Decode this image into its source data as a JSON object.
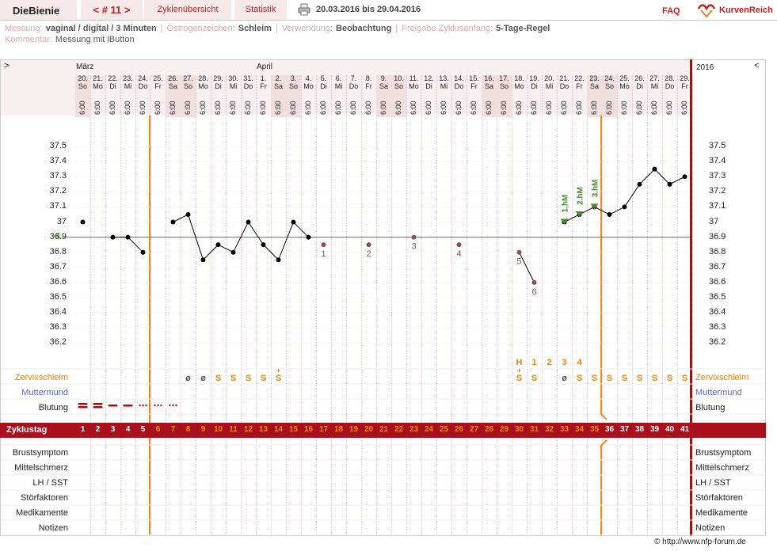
{
  "app": {
    "brand": "DieBienie",
    "cycle": "< # 11 >",
    "tab_overview": "Zyklenübersicht",
    "tab_stats": "Statistik",
    "date_range": "20.03.2016 bis 29.04.2016",
    "faq": "FAQ",
    "kr_logo": "KurvenReich"
  },
  "info": {
    "messung_lbl": "Messung:",
    "messung_val": "vaginal / digital / 3 Minuten",
    "oestro_lbl": "Östrogenzeichen:",
    "oestro_val": "Schleim",
    "verw_lbl": "Verwendung:",
    "verw_val": "Beobachtung",
    "freigabe_lbl": "Freigabe Zyklusanfang:",
    "freigabe_val": "5-Tage-Regel",
    "komm_lbl": "Kommentar:",
    "komm_val": "Messung mit iButton"
  },
  "chart": {
    "nav_left": ">",
    "nav_right": "<",
    "month1": "März",
    "month2": "April",
    "year": "2016",
    "hl_label": "HL",
    "yticks": [
      "37.5",
      "37.4",
      "37.3",
      "37.2",
      "37.1",
      "37",
      "36.9",
      "36.8",
      "36.7",
      "36.6",
      "36.5",
      "36.4",
      "36.3",
      "36.2"
    ],
    "days": [
      {
        "d": "20.",
        "w": "So",
        "we": true
      },
      {
        "d": "21.",
        "w": "Mo"
      },
      {
        "d": "22.",
        "w": "Di"
      },
      {
        "d": "23.",
        "w": "Mi"
      },
      {
        "d": "24.",
        "w": "Do"
      },
      {
        "d": "25.",
        "w": "Fr"
      },
      {
        "d": "26.",
        "w": "Sa",
        "we": true
      },
      {
        "d": "27.",
        "w": "So",
        "we": true
      },
      {
        "d": "28.",
        "w": "Mo"
      },
      {
        "d": "29.",
        "w": "Di"
      },
      {
        "d": "30.",
        "w": "Mi"
      },
      {
        "d": "31.",
        "w": "Do"
      },
      {
        "d": "1.",
        "w": "Fr"
      },
      {
        "d": "2.",
        "w": "Sa",
        "we": true
      },
      {
        "d": "3.",
        "w": "So",
        "we": true
      },
      {
        "d": "4.",
        "w": "Mo"
      },
      {
        "d": "5.",
        "w": "Di"
      },
      {
        "d": "6.",
        "w": "Mi"
      },
      {
        "d": "7.",
        "w": "Do"
      },
      {
        "d": "8.",
        "w": "Fr"
      },
      {
        "d": "9.",
        "w": "Sa",
        "we": true
      },
      {
        "d": "10.",
        "w": "So",
        "we": true
      },
      {
        "d": "11.",
        "w": "Mo"
      },
      {
        "d": "12.",
        "w": "Di"
      },
      {
        "d": "13.",
        "w": "Mi"
      },
      {
        "d": "14.",
        "w": "Do"
      },
      {
        "d": "15.",
        "w": "Fr"
      },
      {
        "d": "16.",
        "w": "Sa",
        "we": true
      },
      {
        "d": "17.",
        "w": "So",
        "we": true
      },
      {
        "d": "18.",
        "w": "Mo"
      },
      {
        "d": "19.",
        "w": "Di"
      },
      {
        "d": "20.",
        "w": "Mi"
      },
      {
        "d": "21.",
        "w": "Do"
      },
      {
        "d": "22.",
        "w": "Fr"
      },
      {
        "d": "23.",
        "w": "Sa",
        "we": true
      },
      {
        "d": "24.",
        "w": "So",
        "we": true
      },
      {
        "d": "25.",
        "w": "Mo"
      },
      {
        "d": "26.",
        "w": "Di"
      },
      {
        "d": "27.",
        "w": "Mi"
      },
      {
        "d": "28.",
        "w": "Do"
      },
      {
        "d": "29.",
        "w": "Fr"
      }
    ],
    "time": "6:00",
    "temps": [
      37.0,
      null,
      36.9,
      36.9,
      36.8,
      null,
      37.0,
      37.05,
      36.75,
      36.85,
      36.8,
      37.0,
      36.85,
      36.75,
      37.0,
      36.9,
      36.85,
      null,
      null,
      36.85,
      null,
      null,
      36.9,
      null,
      null,
      36.85,
      null,
      null,
      null,
      36.8,
      36.6,
      null,
      37.0,
      37.05,
      37.1,
      37.05,
      37.1,
      37.25,
      37.35,
      37.25,
      37.3
    ],
    "excluded": [
      {
        "day": 17,
        "n": "1"
      },
      {
        "day": 20,
        "n": "2"
      },
      {
        "day": 23,
        "n": "3"
      },
      {
        "day": 26,
        "n": "4"
      },
      {
        "day": 30,
        "n": "5"
      },
      {
        "day": 31,
        "n": "6"
      }
    ],
    "hm": [
      {
        "day": 33,
        "t": "1.hM"
      },
      {
        "day": 34,
        "t": "2.hM"
      },
      {
        "day": 35,
        "t": "3.hM"
      }
    ],
    "cervix_top": [
      {
        "day": 30,
        "t": "H"
      },
      {
        "day": 31,
        "t": "1"
      },
      {
        "day": 32,
        "t": "2"
      },
      {
        "day": 33,
        "t": "3"
      },
      {
        "day": 34,
        "t": "4"
      }
    ],
    "cervix": [
      {
        "day": 8,
        "t": "ø",
        "c": "#555"
      },
      {
        "day": 9,
        "t": "ø",
        "c": "#555"
      },
      {
        "day": 10,
        "t": "S"
      },
      {
        "day": 11,
        "t": "S"
      },
      {
        "day": 12,
        "t": "S"
      },
      {
        "day": 13,
        "t": "S"
      },
      {
        "day": 14,
        "t": "S̈",
        "plus": true
      },
      {
        "day": 30,
        "t": "S",
        "plus": true
      },
      {
        "day": 31,
        "t": "S"
      },
      {
        "day": 33,
        "t": "ø",
        "c": "#555"
      },
      {
        "day": 34,
        "t": "S"
      },
      {
        "day": 35,
        "t": "S"
      },
      {
        "day": 36,
        "t": "S"
      },
      {
        "day": 37,
        "t": "S"
      },
      {
        "day": 38,
        "t": "S"
      },
      {
        "day": 39,
        "t": "S"
      },
      {
        "day": 40,
        "t": "S"
      },
      {
        "day": 41,
        "t": "S"
      }
    ],
    "bleeding": [
      {
        "day": 1,
        "k": "heavy"
      },
      {
        "day": 2,
        "k": "heavy"
      },
      {
        "day": 3,
        "k": "medium"
      },
      {
        "day": 4,
        "k": "medium"
      },
      {
        "day": 5,
        "k": "light"
      },
      {
        "day": 6,
        "k": "light"
      },
      {
        "day": 7,
        "k": "light"
      }
    ],
    "rows_left": [
      "Zervixschleim",
      "Muttermund",
      "Blutung"
    ],
    "rows_bottom": [
      "Brustsymptom",
      "Mittelschmerz",
      "LH / SST",
      "Störfaktoren",
      "Medikamente",
      "Notizen"
    ],
    "zyklustag": "Zyklustag",
    "credit": "© http://www.nfp-forum.de"
  },
  "colors": {
    "accent": "#c81e1e",
    "orange": "#f08a1a",
    "green": "#4a8a2a",
    "band": "#a8101e"
  }
}
